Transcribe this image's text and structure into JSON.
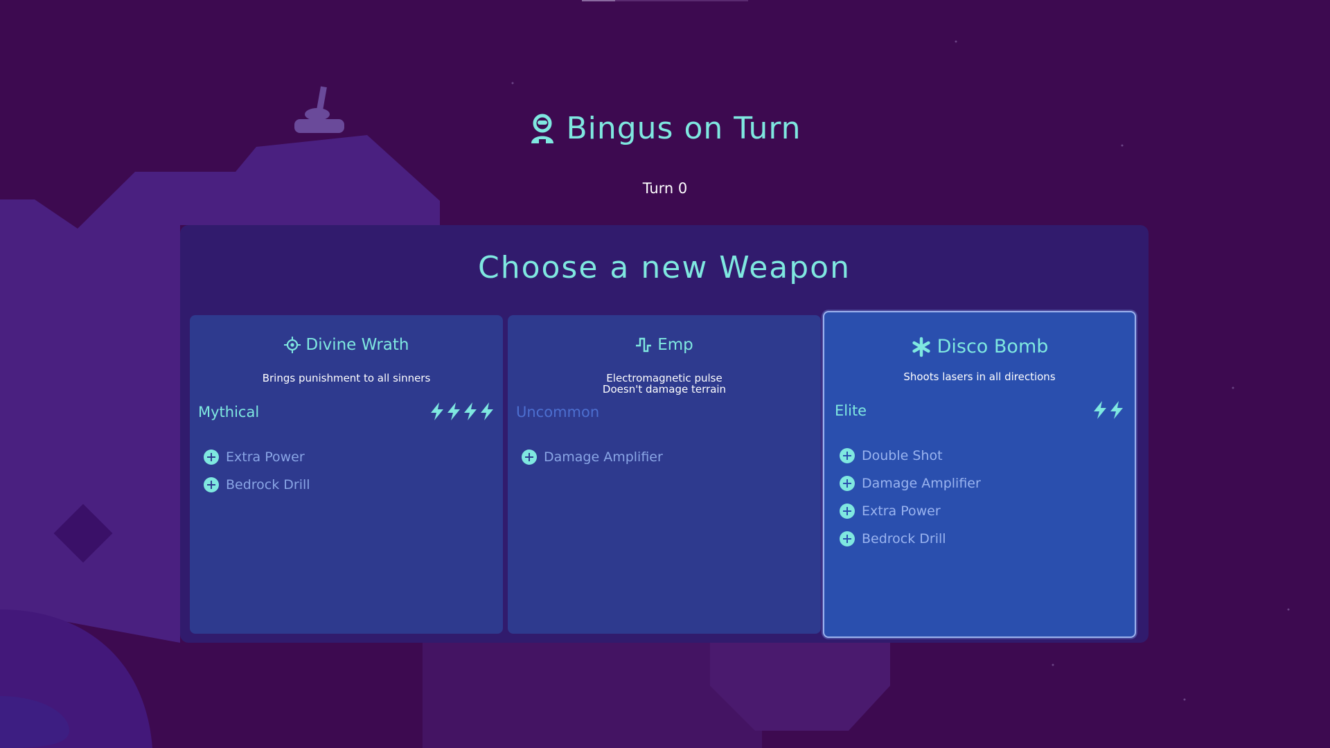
{
  "hud": {
    "player_title": "Bingus on Turn",
    "player_icon": "player-avatar-icon",
    "turn_label": "Turn 0"
  },
  "weapon_select": {
    "title": "Choose a new Weapon",
    "cards": [
      {
        "name": "Divine Wrath",
        "icon": "crosshair-icon",
        "description_lines": [
          "Brings punishment to all sinners"
        ],
        "rarity": "Mythical",
        "power_level": 4,
        "upgrades": [
          "Extra Power",
          "Bedrock Drill"
        ],
        "selected": false
      },
      {
        "name": "Emp",
        "icon": "pulse-icon",
        "description_lines": [
          "Electromagnetic pulse",
          "Doesn't damage terrain"
        ],
        "rarity": "Uncommon",
        "power_level": 0,
        "upgrades": [
          "Damage Amplifier"
        ],
        "selected": false
      },
      {
        "name": "Disco Bomb",
        "icon": "asterisk-icon",
        "description_lines": [
          "Shoots lasers in all directions"
        ],
        "rarity": "Elite",
        "power_level": 2,
        "upgrades": [
          "Double Shot",
          "Damage Amplifier",
          "Extra Power",
          "Bedrock Drill"
        ],
        "selected": true
      }
    ]
  },
  "colors": {
    "background": "#3d0a50",
    "accent": "#7fe8e0",
    "card": "#2e3a8e",
    "card_selected": "#2a4fae"
  }
}
